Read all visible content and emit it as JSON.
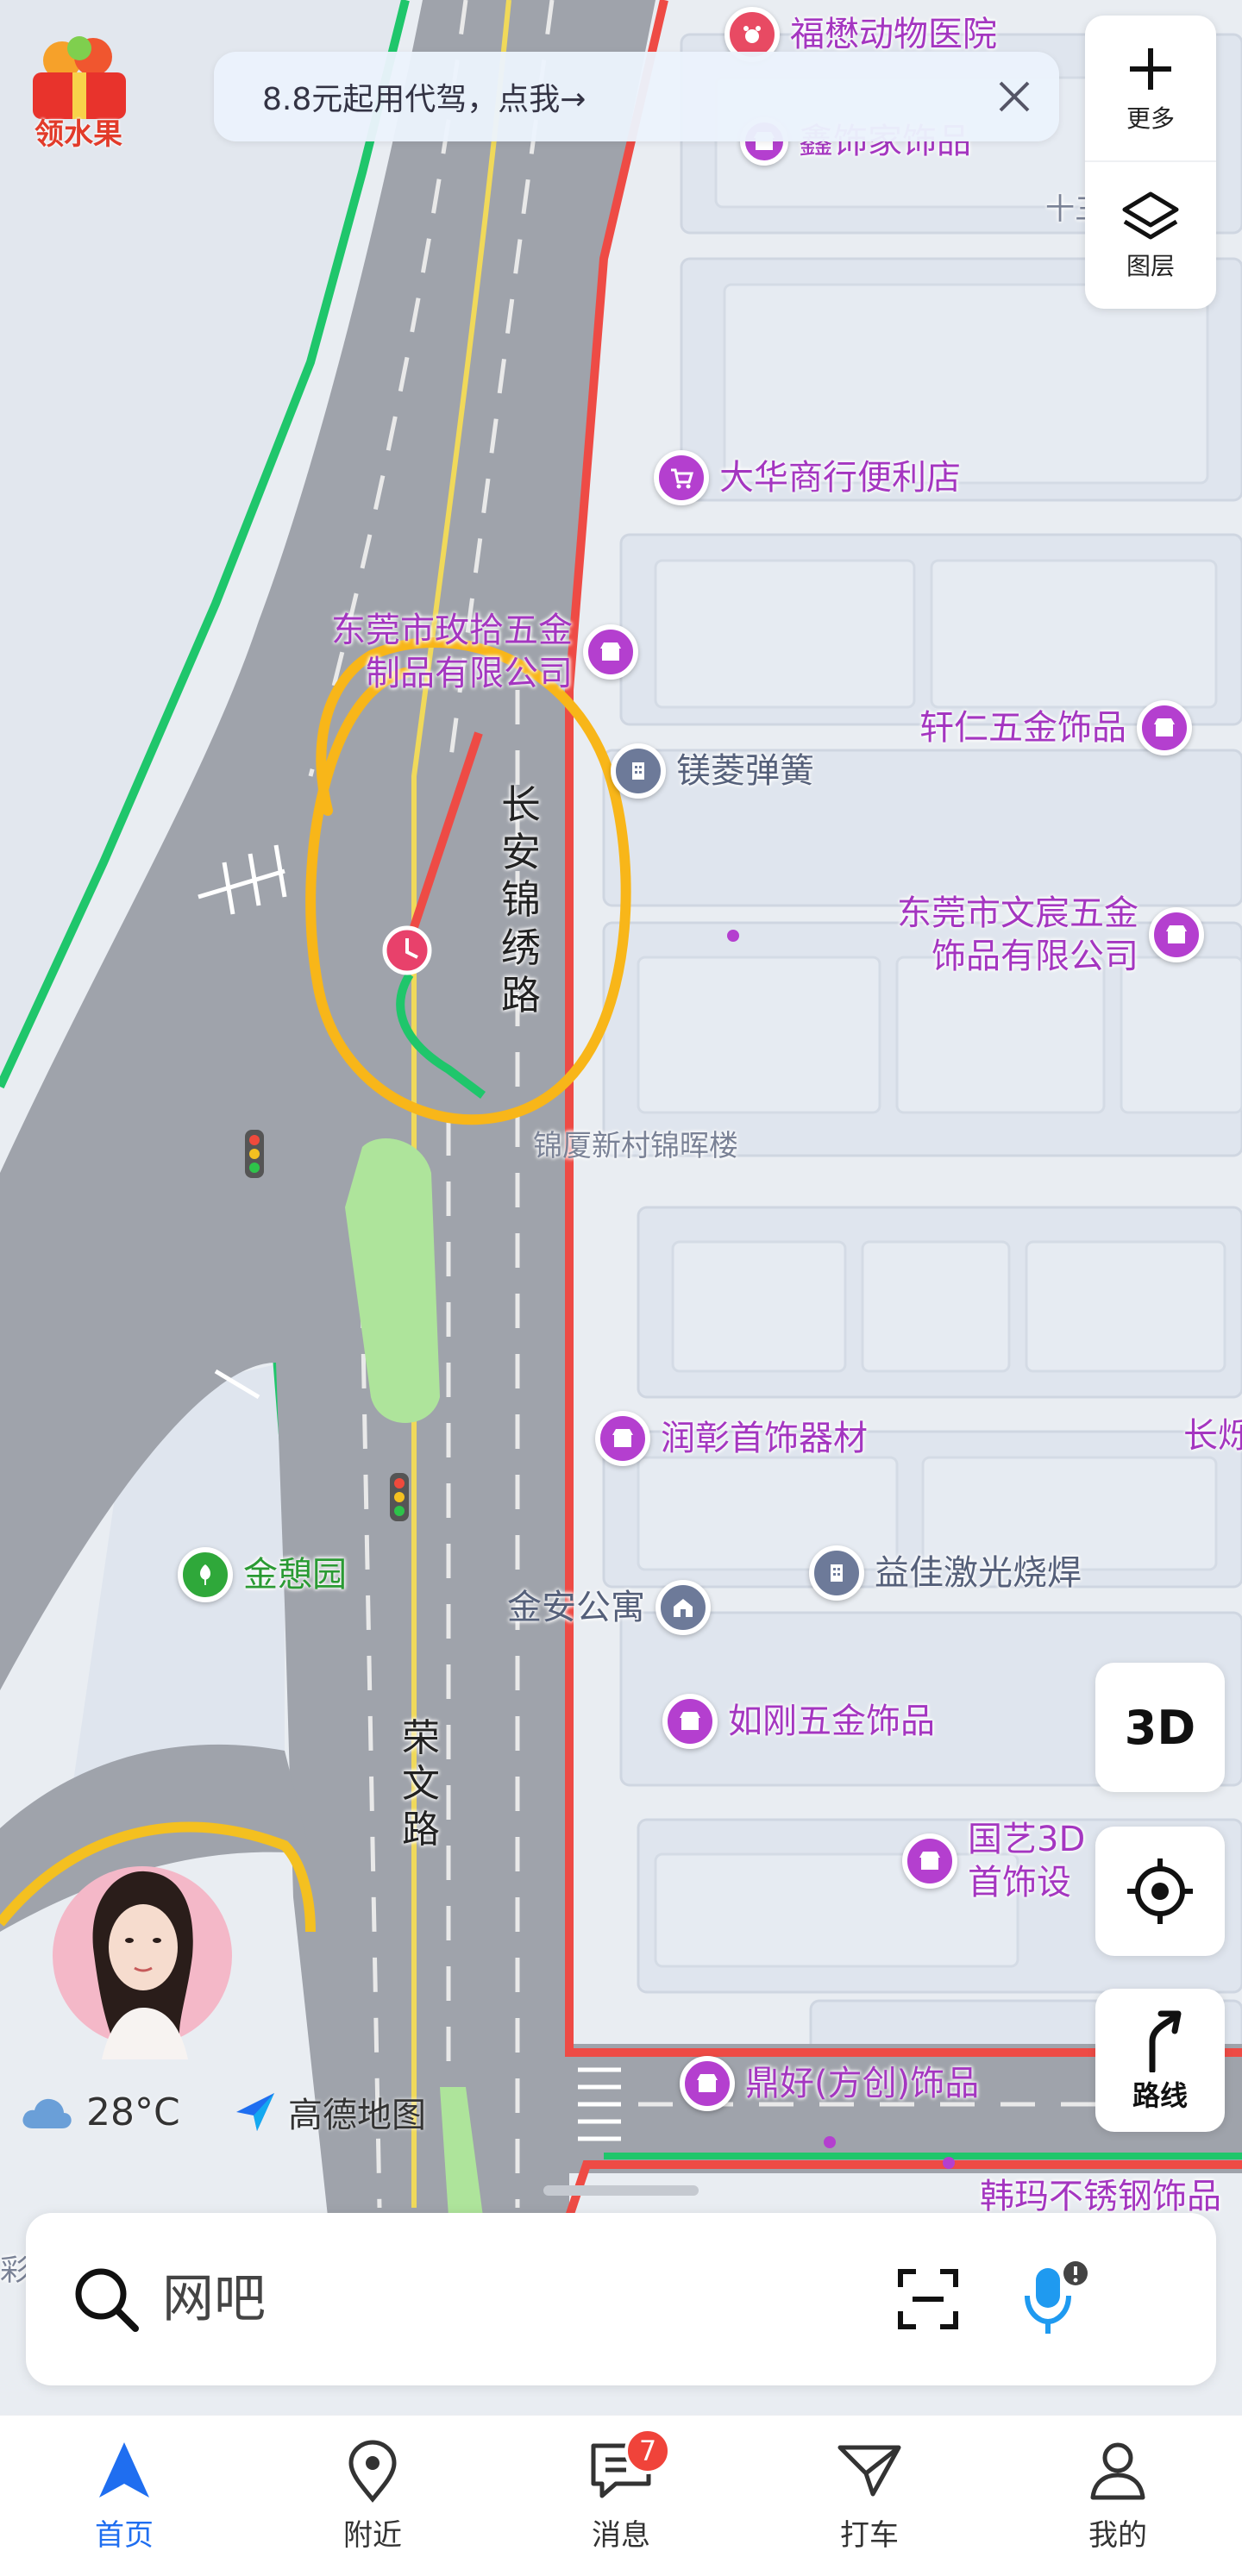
{
  "promo": {
    "gift_label": "领水果"
  },
  "banner": {
    "text": "8.8元起用代驾，点我→"
  },
  "side_controls": {
    "more_label": "更多",
    "layers_label": "图层"
  },
  "map_controls": {
    "btn_3d": "3D",
    "route_label": "路线"
  },
  "weather": {
    "temperature": "28°C",
    "icon": "cloud-icon"
  },
  "brand": {
    "name": "高德地图"
  },
  "pois": {
    "fulin": "福懋动物医院",
    "xinshi": "鑫饰家饰品",
    "shisan": "十三",
    "dahua": "大华商行便利店",
    "meiling_1": "东莞市玫拾五金",
    "meiling_2": "制品有限公司",
    "xuanren": "轩仁五金饰品",
    "nieling": "镁菱弹簧",
    "wenchen_1": "东莞市文宸五金",
    "wenchen_2": "饰品有限公司",
    "jinxia": "锦厦新村锦晖楼",
    "runzhang": "润彰首饰器材",
    "changshuo": "长烁",
    "yijia": "益佳激光烧焊",
    "jinqi": "金憩园",
    "jinan": "金安公寓",
    "rugang": "如刚五金饰品",
    "guoyi_1": "国艺3D",
    "guoyi_2": "首饰设",
    "dinghao": "鼎好(方创)饰品",
    "hanma": "韩玛不锈钢饰品",
    "cai": "彩"
  },
  "roads": {
    "changan": "长安锦绣路",
    "rongwen": "荣文路"
  },
  "search": {
    "placeholder": "网吧"
  },
  "nav": {
    "items": [
      {
        "label": "首页",
        "icon": "navigate-arrow-icon"
      },
      {
        "label": "附近",
        "icon": "location-pin-icon"
      },
      {
        "label": "消息",
        "icon": "message-icon",
        "badge": "7"
      },
      {
        "label": "打车",
        "icon": "taxi-icon"
      },
      {
        "label": "我的",
        "icon": "user-icon"
      }
    ]
  },
  "colors": {
    "accent": "#1f6ef0",
    "poi_purple": "#b43fcf",
    "road_red": "#ee4b45",
    "road_green": "#1fc66b",
    "highlight": "#f8b619"
  }
}
